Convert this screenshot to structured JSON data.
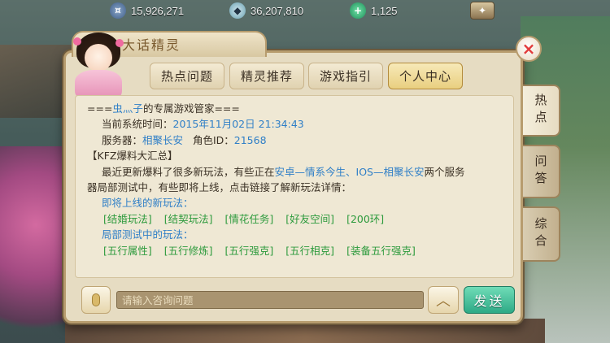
{
  "resources": {
    "coins": "15,926,271",
    "silver": "36,207,810",
    "jade": "1,125",
    "coins_icon": "coin-icon",
    "silver_icon": "silver-ingot-icon",
    "jade_icon": "jade-icon"
  },
  "dialog": {
    "title": "大话精灵",
    "close_symbol": "×",
    "tabs": [
      {
        "label": "热点问题",
        "active": false
      },
      {
        "label": "精灵推荐",
        "active": false
      },
      {
        "label": "游戏指引",
        "active": false
      },
      {
        "label": "个人中心",
        "active": true
      }
    ],
    "side_tabs": [
      {
        "label": "热点",
        "active": true
      },
      {
        "label": "问答",
        "active": false
      },
      {
        "label": "综合",
        "active": false
      }
    ]
  },
  "content": {
    "header_prefix": "===",
    "header_name": "虫灬子",
    "header_suffix": "的专属游戏管家===",
    "time_label": "当前系统时间：",
    "time_value": "2015年11月02日 21:34:43",
    "server_label": "服务器：",
    "server_value": "相聚长安",
    "role_label": "角色ID：",
    "role_value": "21568",
    "section_title": "【KFZ爆料大汇总】",
    "para_1a": "最近更新爆料了很多新玩法，有些正在",
    "para_1b": "安卓—情系今生、IOS—相聚长安",
    "para_1c": "两个服务",
    "para_2": "器局部测试中，有些即将上线，点击链接了解新玩法详情：",
    "upcoming_title": "即将上线的新玩法：",
    "upcoming": [
      "[结婚玩法]",
      "[结契玩法]",
      "[情花任务]",
      "[好友空间]",
      "[200环]"
    ],
    "testing_title": "局部测试中的玩法：",
    "testing": [
      "[五行属性]",
      "[五行修炼]",
      "[五行强克]",
      "[五行相克]",
      "[装备五行强克]"
    ]
  },
  "input": {
    "placeholder": "请输入咨询问题",
    "send_label": "发送",
    "up_symbol": "︿"
  }
}
